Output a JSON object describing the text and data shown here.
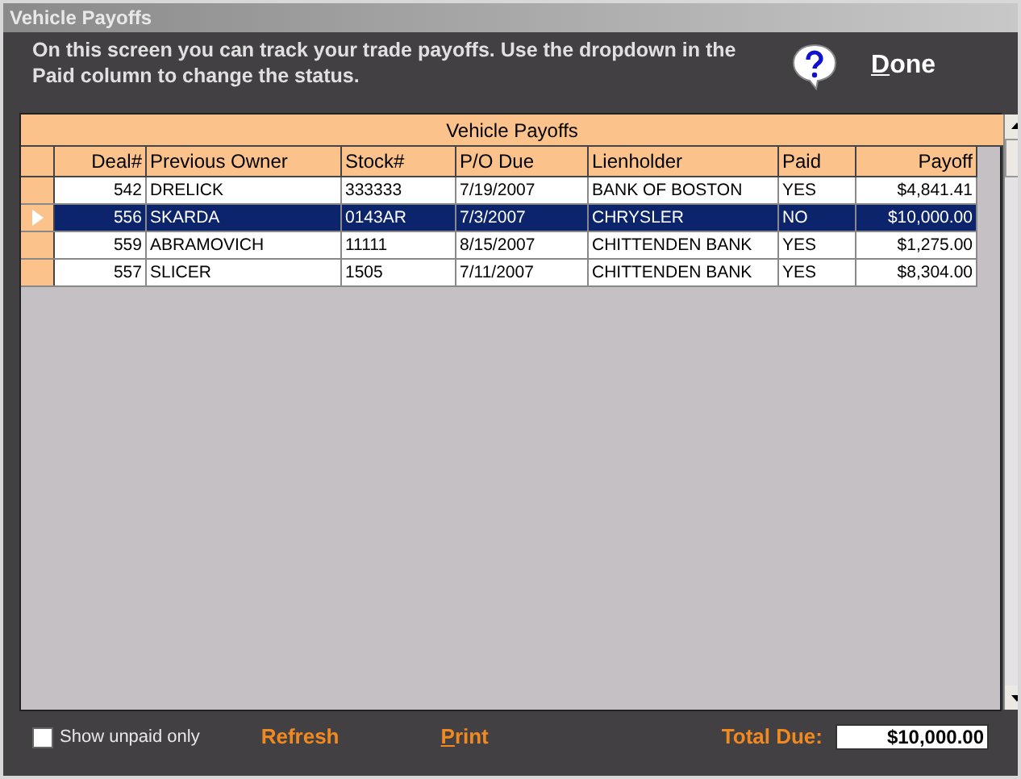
{
  "window": {
    "title": "Vehicle Payoffs"
  },
  "instructions": "On this screen you can track your trade payoffs. Use the dropdown in the Paid column to change the status.",
  "done_button": "Done",
  "grid": {
    "title": "Vehicle Payoffs",
    "columns": [
      {
        "label": "Deal#",
        "kind": "number"
      },
      {
        "label": "Previous Owner",
        "kind": "text"
      },
      {
        "label": "Stock#",
        "kind": "text"
      },
      {
        "label": "P/O Due",
        "kind": "text"
      },
      {
        "label": "Lienholder",
        "kind": "text"
      },
      {
        "label": "Paid",
        "kind": "text"
      },
      {
        "label": "Payoff",
        "kind": "number"
      }
    ],
    "rows": [
      {
        "selected": false,
        "cells": [
          "542",
          "DRELICK",
          "333333",
          "7/19/2007",
          "BANK OF BOSTON",
          "YES",
          "$4,841.41"
        ]
      },
      {
        "selected": true,
        "cells": [
          "556",
          "SKARDA",
          "0143AR",
          "7/3/2007",
          "CHRYSLER",
          "NO",
          "$10,000.00"
        ]
      },
      {
        "selected": false,
        "cells": [
          "559",
          "ABRAMOVICH",
          "11111",
          "8/15/2007",
          "CHITTENDEN BANK",
          "YES",
          "$1,275.00"
        ]
      },
      {
        "selected": false,
        "cells": [
          "557",
          "SLICER",
          "1505",
          "7/11/2007",
          "CHITTENDEN BANK",
          "YES",
          "$8,304.00"
        ]
      }
    ]
  },
  "show_unpaid_only": {
    "label": "Show unpaid only",
    "checked": false
  },
  "refresh_button": "Refresh",
  "print_button": "Print",
  "total_due": {
    "label": "Total Due:",
    "value": "$10,000.00"
  }
}
